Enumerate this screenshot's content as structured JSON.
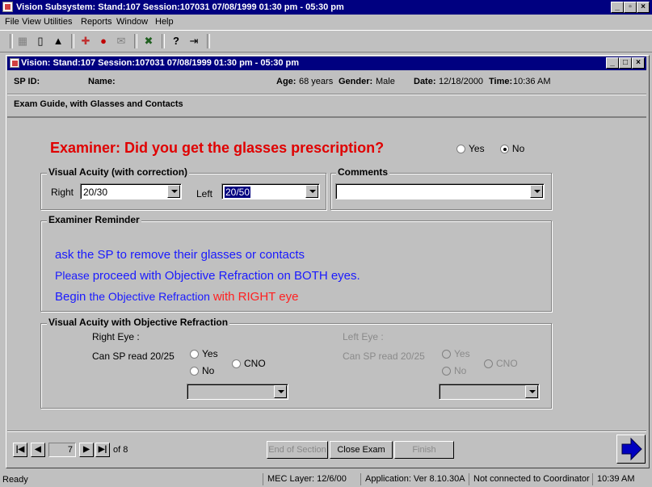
{
  "app": {
    "title": "Vision Subsystem: Stand:107 Session:107031 07/08/1999 01:30 pm - 05:30 pm",
    "menu": [
      "File",
      "View",
      "Utilities",
      "Reports",
      "Window",
      "Help"
    ]
  },
  "child": {
    "title": "Vision: Stand:107 Session:107031 07/08/1999 01:30 pm - 05:30 pm"
  },
  "header": {
    "sp_id_label": "SP ID:",
    "name_label": "Name:",
    "age_label": "Age:",
    "age_value": "68 years",
    "gender_label": "Gender:",
    "gender_value": "Male",
    "date_label": "Date:",
    "date_value": "12/18/2000",
    "time_label": "Time:",
    "time_value": "10:36 AM",
    "section_title": "Exam Guide, with Glasses and Contacts"
  },
  "question": {
    "text": "Examiner: Did you get the glasses prescription?",
    "yes": "Yes",
    "no": "No",
    "selected": "No"
  },
  "visual_acuity": {
    "title": "Visual Acuity (with correction)",
    "right_label": "Right",
    "right_value": "20/30",
    "left_label": "Left",
    "left_value": "20/50"
  },
  "comments": {
    "title": "Comments",
    "value": ""
  },
  "reminder": {
    "title": "Examiner Reminder",
    "line1": "ask the SP to remove their glasses or contacts",
    "line2_a": "Please ",
    "line2_b": "proceed with Objective Refraction on BOTH eyes.",
    "line3_a": "Begin ",
    "line3_b": "the Objective Refraction ",
    "line3_c": "with RIGHT eye"
  },
  "objective": {
    "title": "Visual Acuity with Objective Refraction",
    "right_eye_label": "Right Eye :",
    "left_eye_label": "Left Eye :",
    "can_read_label": "Can SP read 20/25",
    "yes": "Yes",
    "no": "No",
    "cno": "CNO"
  },
  "footer": {
    "page_value": "7",
    "page_of": "of 8",
    "end_section": "End of Section",
    "close_exam": "Close Exam",
    "finish": "Finish"
  },
  "status": {
    "ready": "Ready",
    "mec_layer": "MEC Layer: 12/6/00",
    "application": "Application: Ver 8.10.30A",
    "connection": "Not connected to Coordinator",
    "clock": "10:39 AM"
  }
}
